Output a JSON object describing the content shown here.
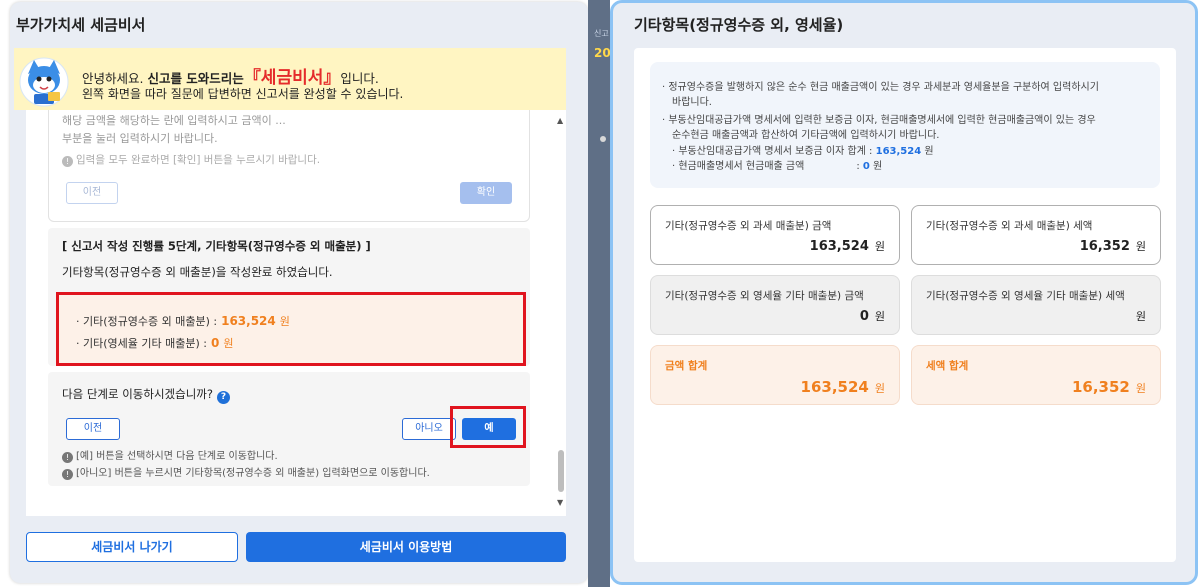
{
  "left": {
    "title": "부가가치세 세금비서",
    "greeting": {
      "prefix": "안녕하세요. ",
      "bold": "신고를 도와드리는",
      "brand": "『세금비서』",
      "suffix": "입니다.",
      "line2": "왼쪽 화면을 따라 질문에 답변하면 신고서를 완성할 수 있습니다."
    },
    "faded": {
      "line1": "해당 금액을 해당하는 란에 입력하시고 금액이 ...",
      "line2": "부분을 눌러 입력하시기 바랍니다.",
      "hint": "입력을 모두 완료하면 [확인] 버튼을 누르시기 바랍니다.",
      "prev_label": "이전",
      "ok_label": "확인"
    },
    "step": {
      "title": "[ 신고서 작성 진행률 5단계, 기타항목(정규영수증 외 매출분) ]",
      "desc": "기타항목(정규영수증 외 매출분)을 작성완료 하였습니다.",
      "row1_label": "· 기타(정규영수증 외 매출분) :",
      "row1_value": "163,524",
      "row1_unit": "원",
      "row2_label": "· 기타(영세율 기타 매출분) :",
      "row2_value": "0",
      "row2_unit": "원"
    },
    "next": {
      "question": "다음 단계로 이동하시겠습니까?",
      "help": "?",
      "prev_label": "이전",
      "no_label": "아니오",
      "yes_label": "예",
      "note1": "[예] 버튼을 선택하시면 다음 단계로 이동합니다.",
      "note2": "[아니오] 버튼을 누르시면 기타항목(정규영수증 외 매출분) 입력화면으로 이동합니다."
    },
    "buttons": {
      "exit": "세금비서 나가기",
      "howto": "세금비서 이용방법"
    }
  },
  "strip": {
    "s1": "신고",
    "s2": "20"
  },
  "right": {
    "title": "기타항목(정규영수증 외, 영세율)",
    "info": {
      "l1": "· 정규영수증을 발행하지 않은 순수 현금 매출금액이 있는 경우 과세분과 영세율분을 구분하여 입력하시기",
      "l2": "바랍니다.",
      "l3": "· 부동산임대공급가액 명세서에 입력한 보증금 이자, 현금매출명세서에 입력한 현금매출금액이 있는 경우",
      "l4": "순수현금 매출금액과 합산하여 기타금액에 입력하시기 바랍니다.",
      "l5_label": "· 부동산임대공급가액 명세서 보증금 이자 합계 :",
      "l5_value": "163,524",
      "l5_unit": "원",
      "l6_label": "· 현금매출명세서 현금매출 금액",
      "l6_colon": ":",
      "l6_value": "0",
      "l6_unit": "원"
    },
    "cards": {
      "c1_label": "기타(정규영수증 외 과세 매출분) 금액",
      "c1_value": "163,524",
      "c2_label": "기타(정규영수증 외 과세 매출분) 세액",
      "c2_value": "16,352",
      "c3_label": "기타(정규영수증 외 영세율 기타 매출분) 금액",
      "c3_value": "0",
      "c4_label": "기타(정규영수증 외 영세율 기타 매출분) 세액",
      "c4_value": "",
      "c5_label": "금액 합계",
      "c5_value": "163,524",
      "c6_label": "세액 합계",
      "c6_value": "16,352",
      "unit": "원"
    }
  }
}
